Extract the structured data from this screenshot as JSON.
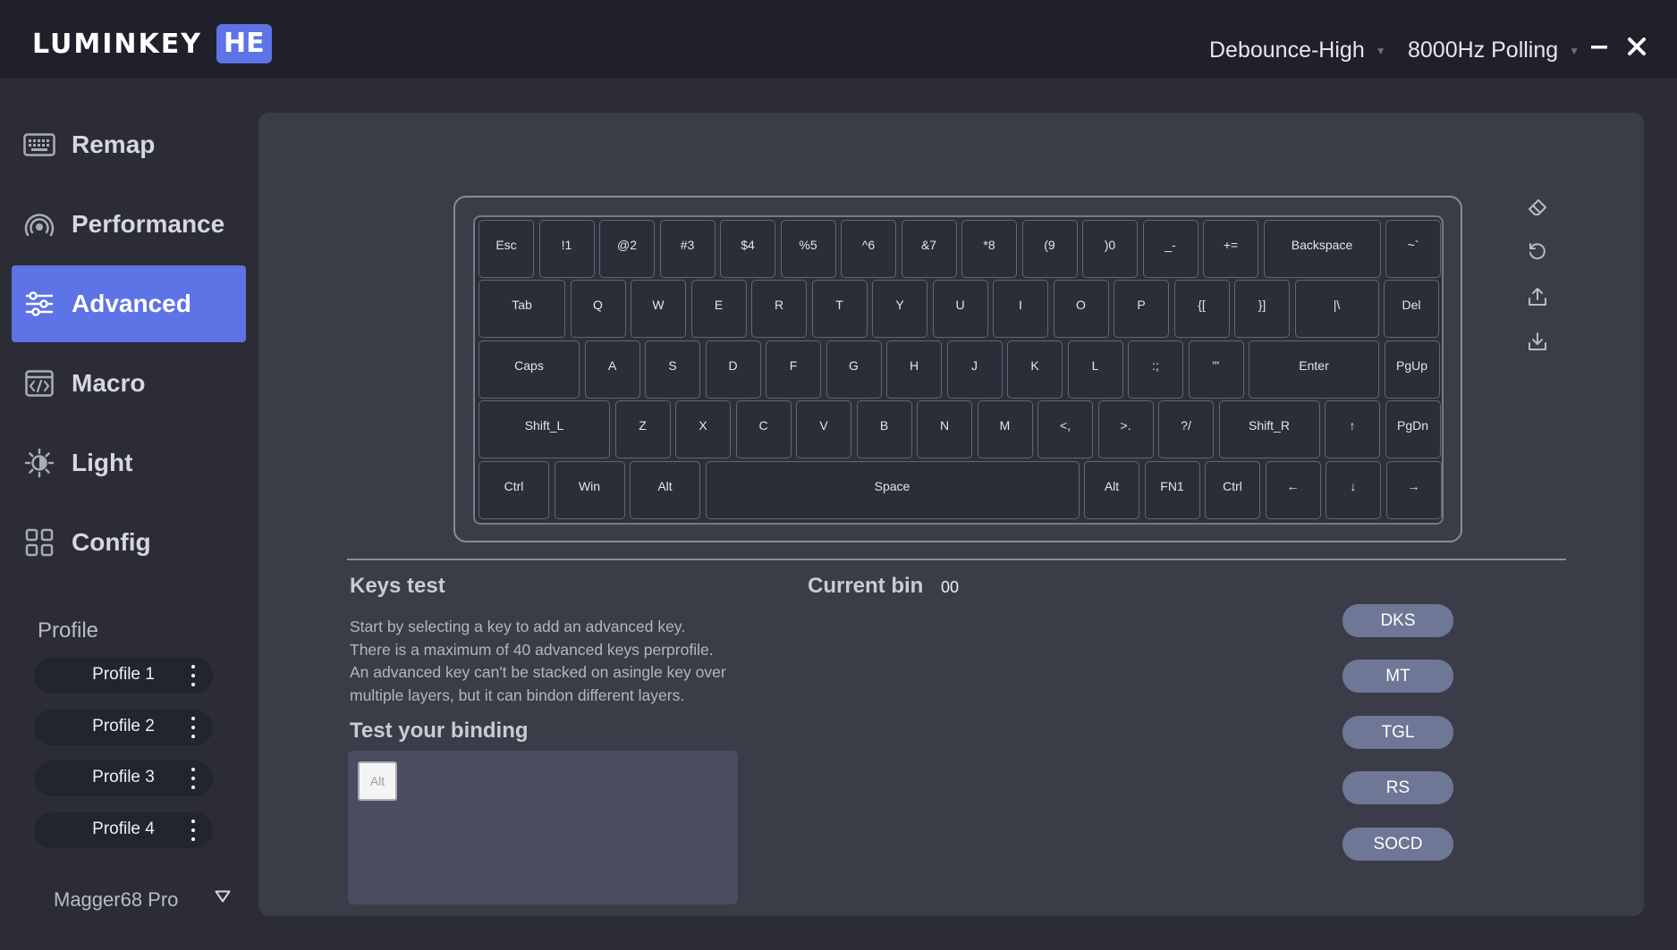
{
  "app": {
    "logo_text": "LUMINKEY",
    "logo_badge": "HE"
  },
  "titlebar": {
    "debounce": "Debounce-High",
    "polling": "8000Hz Polling",
    "minimize": "–",
    "close": "✕"
  },
  "sidebar": {
    "items": [
      {
        "label": "Remap",
        "icon": "keyboard-icon"
      },
      {
        "label": "Performance",
        "icon": "signal-icon"
      },
      {
        "label": "Advanced",
        "icon": "sliders-icon",
        "active": true
      },
      {
        "label": "Macro",
        "icon": "code-window-icon"
      },
      {
        "label": "Light",
        "icon": "sun-icon"
      },
      {
        "label": "Config",
        "icon": "grid-icon"
      }
    ],
    "profile_heading": "Profile",
    "profiles": [
      "Profile 1",
      "Profile 2",
      "Profile 3",
      "Profile 4"
    ],
    "device": "Magger68 Pro"
  },
  "keyboard": {
    "rows": [
      [
        "Esc",
        "!1",
        "@2",
        "#3",
        "$4",
        "%5",
        "^6",
        "&7",
        "*8",
        "(9",
        ")0",
        "_-",
        "+=",
        "Backspace",
        "~`"
      ],
      [
        "Tab",
        "Q",
        "W",
        "E",
        "R",
        "T",
        "Y",
        "U",
        "I",
        "O",
        "P",
        "{[",
        "}]",
        "|\\",
        "Del"
      ],
      [
        "Caps",
        "A",
        "S",
        "D",
        "F",
        "G",
        "H",
        "J",
        "K",
        "L",
        ":;",
        "\"'",
        "Enter",
        "PgUp"
      ],
      [
        "Shift_L",
        "Z",
        "X",
        "C",
        "V",
        "B",
        "N",
        "M",
        "<,",
        ">.",
        "?/",
        "Shift_R",
        "↑",
        "PgDn"
      ],
      [
        "Ctrl",
        "Win",
        "Alt",
        "Space",
        "Alt",
        "FN1",
        "Ctrl",
        "←",
        "↓",
        "→"
      ]
    ]
  },
  "tools": [
    "eraser-icon",
    "reset-icon",
    "export-icon",
    "import-icon"
  ],
  "keys_test": {
    "title": "Keys test",
    "lines": [
      "Start by selecting a key to add an advanced key.",
      "There is a maximum of 40 advanced keys perprofile.",
      "An advanced key can't be stacked on asingle key over",
      "multiple layers, but it can bindon different layers."
    ]
  },
  "current_bin": {
    "label": "Current bin",
    "value": "00"
  },
  "test_binding": {
    "title": "Test your binding",
    "key": "Alt"
  },
  "advanced_buttons": [
    "DKS",
    "MT",
    "TGL",
    "RS",
    "SOCD"
  ],
  "colors": {
    "accent": "#5d73e6",
    "background": "#2b2c36",
    "panel": "#3a3c48",
    "button": "#6e7796"
  }
}
